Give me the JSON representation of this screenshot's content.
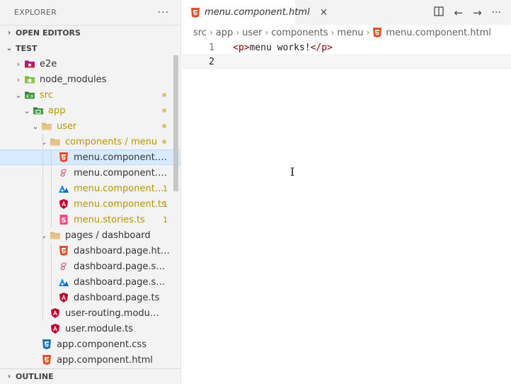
{
  "explorer": {
    "title": "EXPLORER",
    "more": "···"
  },
  "sections": {
    "open_editors": "OPEN EDITORS",
    "test": "TEST",
    "outline": "OUTLINE"
  },
  "tree": [
    {
      "label": "e2e",
      "icon": "e2e-folder-icon",
      "twist": "›",
      "level": 1
    },
    {
      "label": "node_modules",
      "icon": "node-modules-folder-icon",
      "twist": "›",
      "level": 1
    },
    {
      "label": "src",
      "icon": "src-folder-icon",
      "twist": "⌄",
      "level": 1,
      "dot": true,
      "color": "#b89500"
    },
    {
      "label": "app",
      "icon": "app-folder-icon",
      "twist": "⌄",
      "level": 2,
      "dot": true,
      "color": "#b89500"
    },
    {
      "label": "user",
      "icon": "folder-icon",
      "twist": "⌄",
      "level": 3,
      "dot": true,
      "color": "#b89500"
    },
    {
      "label": "components / menu",
      "icon": "folder-icon",
      "twist": "⌄",
      "level": 4,
      "dot": true,
      "color": "#b89500"
    },
    {
      "label": "menu.component.html",
      "icon": "html-file-icon",
      "level": 5,
      "selected": true
    },
    {
      "label": "menu.component.scss",
      "icon": "scss-file-icon",
      "level": 5
    },
    {
      "label": "menu.component.spec.ts",
      "icon": "spec-file-icon",
      "level": 5,
      "badge": "1",
      "mod": true
    },
    {
      "label": "menu.component.ts",
      "icon": "angular-file-icon",
      "level": 5,
      "badge": "1",
      "mod": true
    },
    {
      "label": "menu.stories.ts",
      "icon": "storybook-file-icon",
      "level": 5,
      "badge": "1",
      "mod": true
    },
    {
      "label": "pages / dashboard",
      "icon": "folder-icon",
      "twist": "⌄",
      "level": 4
    },
    {
      "label": "dashboard.page.html",
      "icon": "html-file-icon",
      "level": 5
    },
    {
      "label": "dashboard.page.scss",
      "icon": "scss-file-icon",
      "level": 5
    },
    {
      "label": "dashboard.page.spec.ts",
      "icon": "spec-file-icon",
      "level": 5
    },
    {
      "label": "dashboard.page.ts",
      "icon": "angular-file-icon",
      "level": 5
    },
    {
      "label": "user-routing.module.ts",
      "icon": "angular-file-icon",
      "level": 4
    },
    {
      "label": "user.module.ts",
      "icon": "angular-file-icon",
      "level": 4
    },
    {
      "label": "app.component.css",
      "icon": "css-file-icon",
      "level": 3
    },
    {
      "label": "app.component.html",
      "icon": "html-file-icon",
      "level": 3
    }
  ],
  "tab": {
    "label": "menu.component.html",
    "close": "✕"
  },
  "breadcrumb": [
    "src",
    "app",
    "user",
    "components",
    "menu",
    "menu.component.html"
  ],
  "code": [
    {
      "num": "1",
      "open": "<p>",
      "text": "menu works!",
      "close": "</p>"
    },
    {
      "num": "2",
      "open": "",
      "text": "",
      "close": ""
    }
  ]
}
